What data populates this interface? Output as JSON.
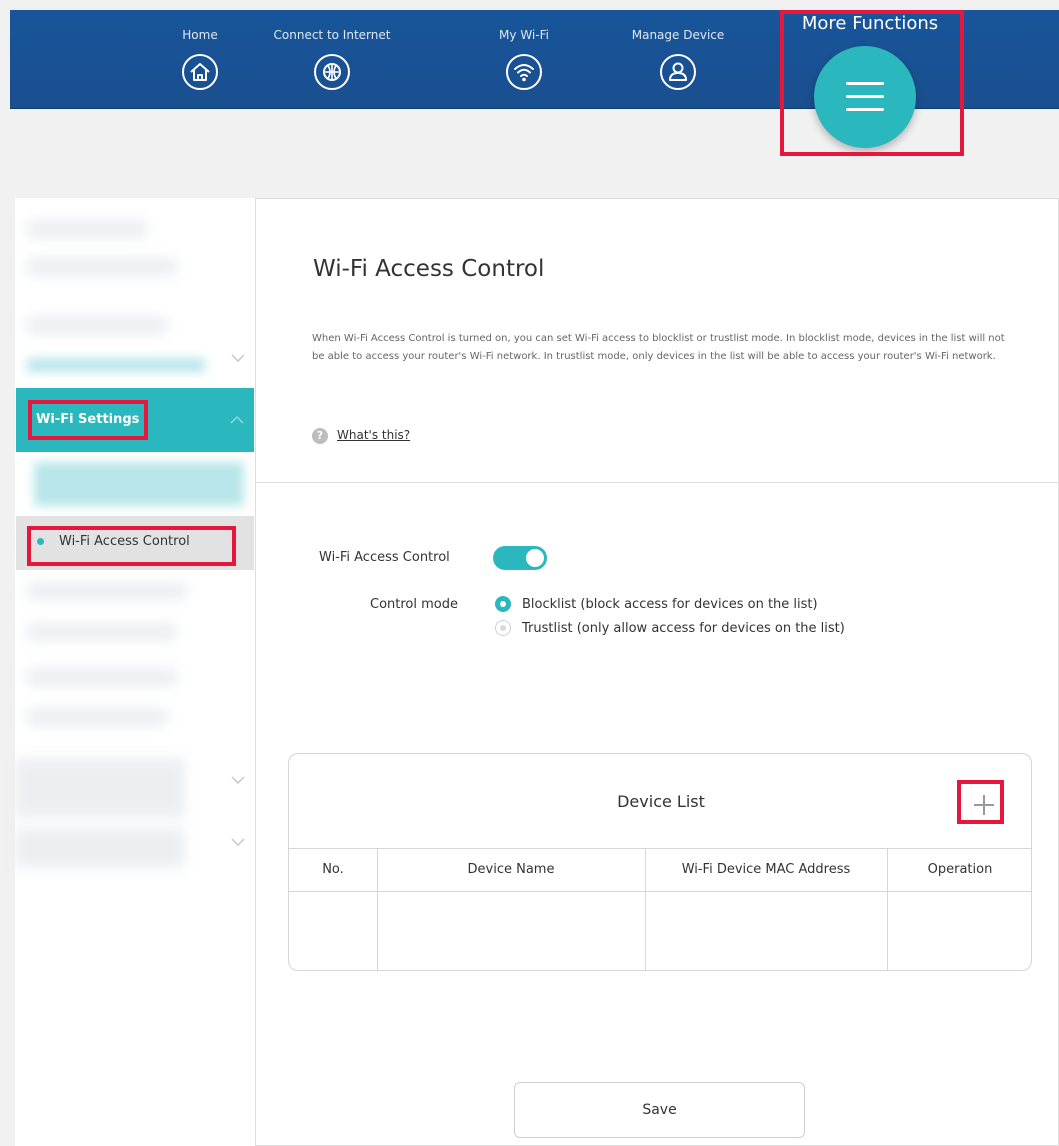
{
  "nav": {
    "items": [
      {
        "label": "Home",
        "icon": "home-icon"
      },
      {
        "label": "Connect to Internet",
        "icon": "globe-icon"
      },
      {
        "label": "My Wi-Fi",
        "icon": "wifi-icon"
      },
      {
        "label": "Manage Device",
        "icon": "user-icon"
      }
    ],
    "more_label": "More Functions",
    "more_icon": "menu-icon"
  },
  "sidebar": {
    "active_section": "Wi-Fi Settings",
    "active_item": "Wi-Fi Access Control"
  },
  "main": {
    "title": "Wi-Fi Access Control",
    "description": "When Wi-Fi Access Control is turned on, you can set Wi-Fi access to blocklist or trustlist mode. In blocklist mode, devices in the list will not be able to access your router's Wi-Fi network. In trustlist mode, only devices in the list will be able to access your router's Wi-Fi network.",
    "help_link": "What's this?",
    "toggle_label": "Wi-Fi Access Control",
    "toggle_on": true,
    "control_mode_label": "Control mode",
    "modes": [
      {
        "label": "Blocklist (block access for devices on the list)",
        "selected": true
      },
      {
        "label": "Trustlist (only allow access for devices on the list)",
        "selected": false
      }
    ]
  },
  "device_list": {
    "title": "Device List",
    "add_icon": "plus-icon",
    "columns": [
      "No.",
      "Device Name",
      "Wi-Fi Device MAC Address",
      "Operation"
    ],
    "rows": []
  },
  "save_label": "Save",
  "colors": {
    "nav_bg": "#18559a",
    "accent": "#2ab7bd",
    "highlight": "#e5173d"
  }
}
